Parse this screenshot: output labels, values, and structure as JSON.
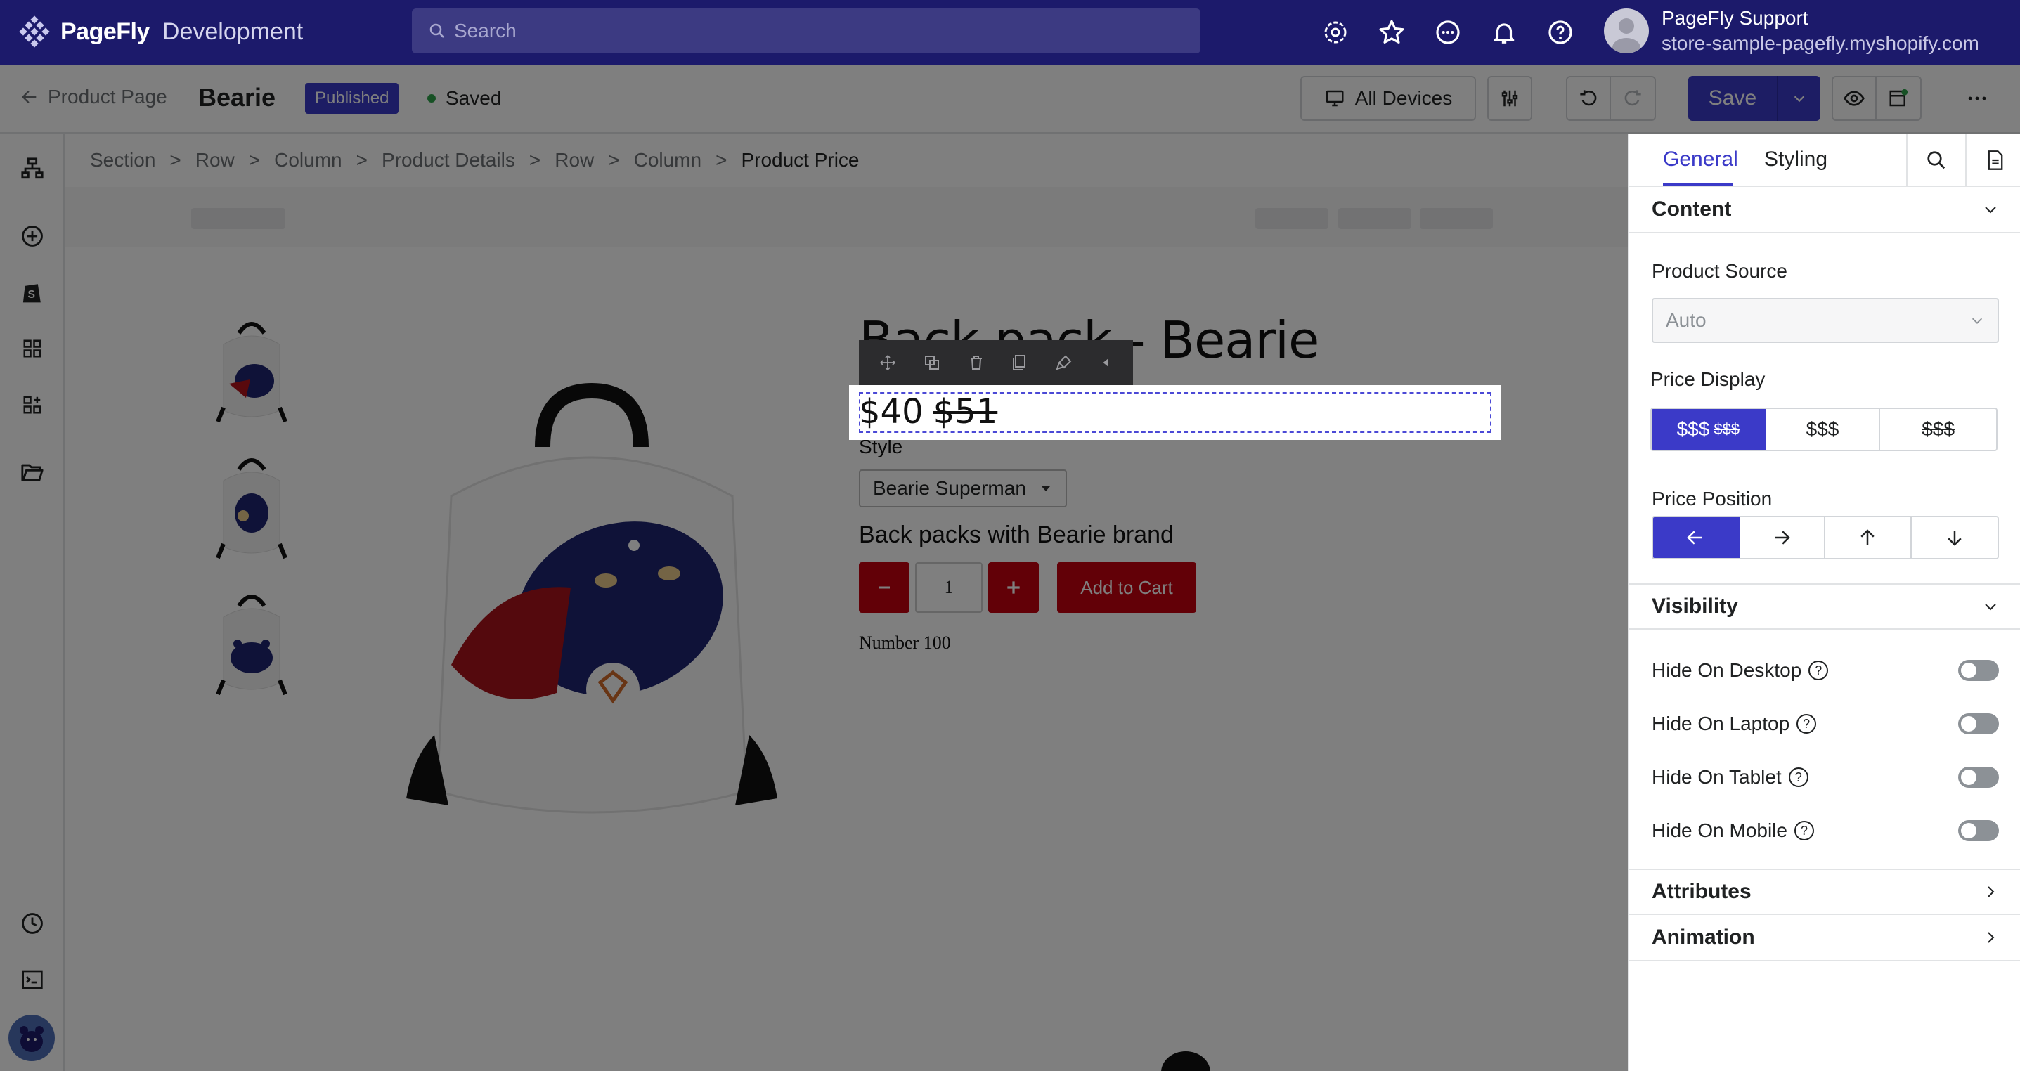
{
  "app": {
    "brand": "PageFly",
    "subtitle": "Development"
  },
  "search": {
    "placeholder": "Search"
  },
  "user": {
    "name": "PageFly Support",
    "store": "store-sample-pagefly.myshopify.com"
  },
  "toolbar": {
    "back_label": "Product Page",
    "page_name": "Bearie",
    "status_badge": "Published",
    "saved_label": "Saved",
    "devices_label": "All Devices",
    "save_label": "Save"
  },
  "breadcrumb": [
    "Section",
    "Row",
    "Column",
    "Product Details",
    "Row",
    "Column",
    "Product Price"
  ],
  "product": {
    "title": "Back pack - Bearie",
    "price": "$40",
    "compare_price": "$51",
    "style_label": "Style",
    "variant": "Bearie Superman",
    "description": "Back packs with Bearie brand",
    "quantity": "1",
    "add_to_cart": "Add to Cart",
    "number_text": "Number 100"
  },
  "panel": {
    "tabs": [
      "General",
      "Styling"
    ],
    "content_title": "Content",
    "product_source_label": "Product Source",
    "product_source_value": "Auto",
    "price_display_label": "Price Display",
    "price_display_options": [
      "$$$",
      "$$$",
      "$$$"
    ],
    "price_display_option1_strike": "$$$",
    "price_display_selected": 0,
    "price_position_label": "Price Position",
    "price_position_options": [
      "arrow-left-icon",
      "arrow-right-icon",
      "arrow-up-icon",
      "arrow-down-icon"
    ],
    "price_position_selected": 0,
    "visibility_title": "Visibility",
    "visibility": [
      {
        "label": "Hide On Desktop",
        "on": false
      },
      {
        "label": "Hide On Laptop",
        "on": false
      },
      {
        "label": "Hide On Tablet",
        "on": false
      },
      {
        "label": "Hide On Mobile",
        "on": false
      }
    ],
    "attributes_title": "Attributes",
    "animation_title": "Animation"
  },
  "colors": {
    "accent": "#3b3ac8",
    "topbar": "#1c1a6b",
    "cart_red": "#c4000f"
  }
}
